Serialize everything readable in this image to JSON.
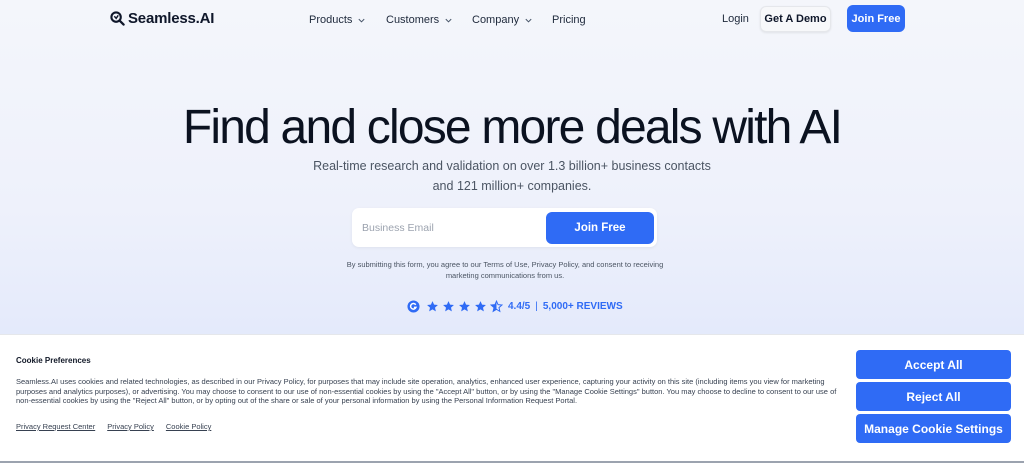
{
  "nav": {
    "logo_text": "Seamless.AI",
    "products": "Products",
    "customers": "Customers",
    "company": "Company",
    "pricing": "Pricing",
    "login": "Login",
    "get_demo": "Get A Demo",
    "join_free": "Join Free"
  },
  "hero": {
    "title": "Find and close more deals with AI",
    "subtitle": "Real-time research and validation on over 1.3 billion+ business contacts and 121 million+ companies.",
    "email_placeholder": "Business Email",
    "join_button": "Join Free",
    "consent_text": "By submitting this form, you agree to our Terms of Use, Privacy Policy, and consent to receiving marketing communications from us.",
    "rating_icon": "g2-logo-icon",
    "rating_value": "4.4/5",
    "rating_separator": "|",
    "rating_reviews": "5,000+ REVIEWS",
    "stars_count": 4.5
  },
  "cookie": {
    "title": "Cookie Preferences",
    "text": "Seamless.AI uses cookies and related technologies, as described in our Privacy Policy, for purposes that may include site operation, analytics, enhanced user experience, capturing your activity on this site (including items you view for marketing purposes and analytics purposes), or advertising. You may choose to consent to our use of non-essential cookies by using the \"Accept All\" button, or by using the \"Manage Cookie Settings\" button. You may choose to decline to consent to our use of non-essential cookies by using the \"Reject All\" button, or by opting out of the share or sale of your personal information by using the Personal Information Request Portal.",
    "links": [
      "Privacy Request Center",
      "Privacy Policy",
      "Cookie Policy"
    ],
    "accept_all": "Accept All",
    "reject_all": "Reject All",
    "manage_settings": "Manage Cookie Settings"
  },
  "colors": {
    "primary_blue": "#2f6bf5",
    "dark_text": "#0b1220"
  }
}
